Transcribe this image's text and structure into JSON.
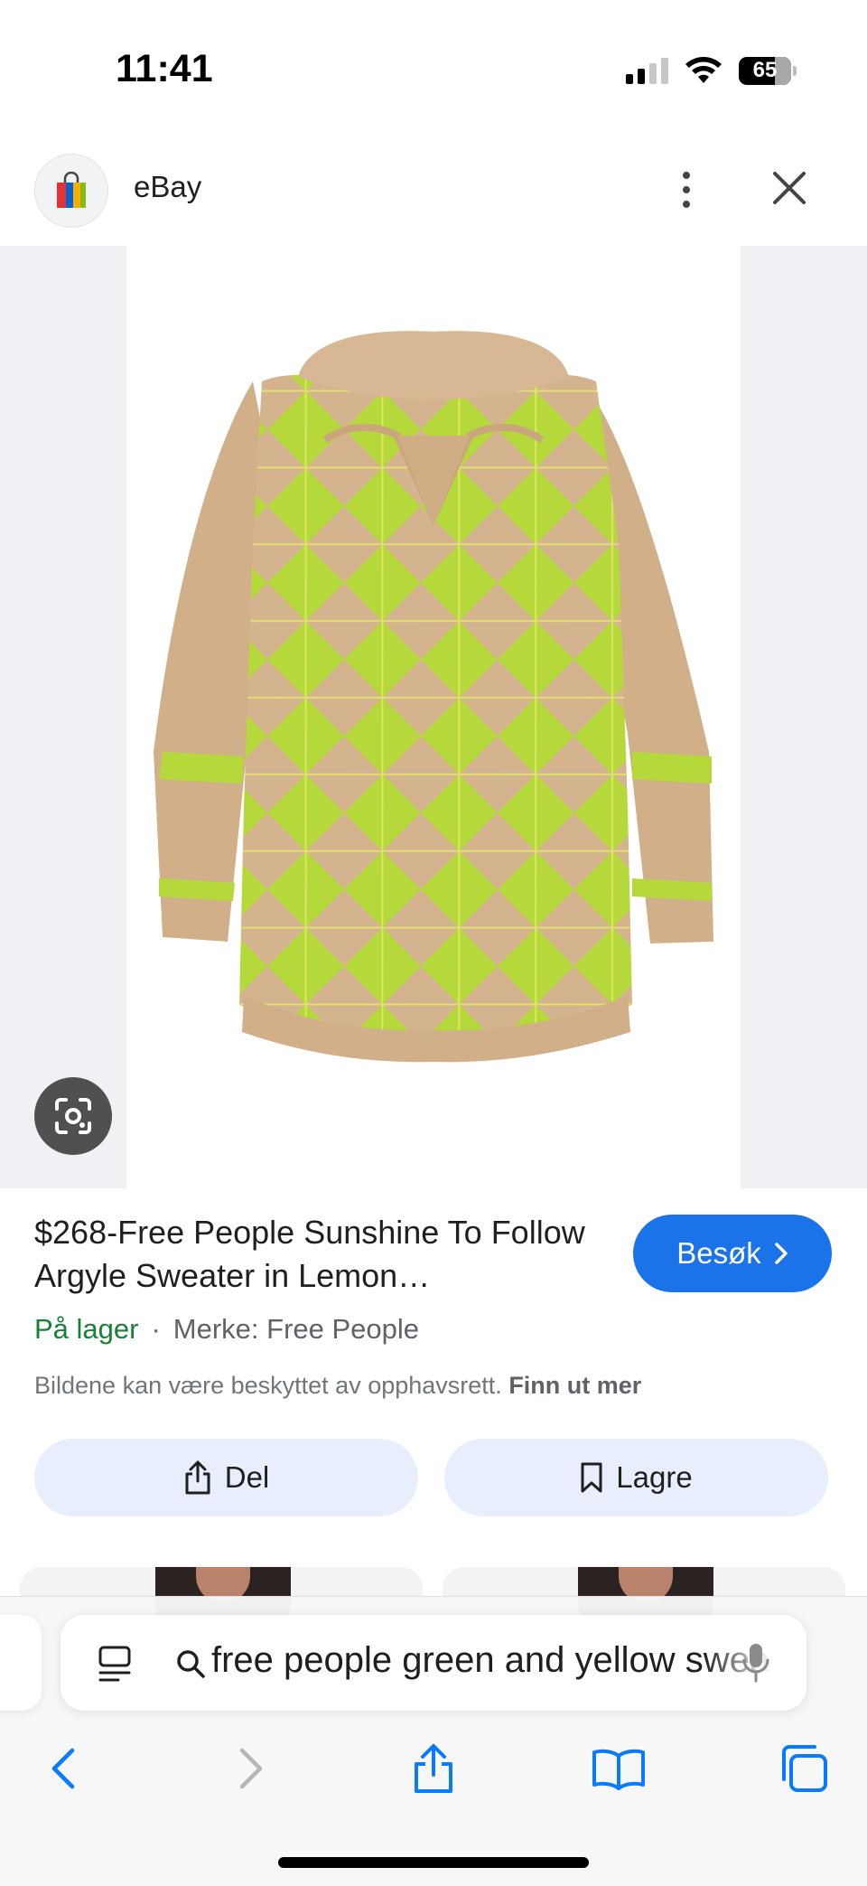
{
  "status_bar": {
    "time": "11:41",
    "battery": "65"
  },
  "site": {
    "name": "eBay",
    "logo_icon": "ebay-shopping-bag-icon"
  },
  "product": {
    "title": "$268-Free People Sunshine To Follow Argyle Sweater in Lemon…",
    "stock_status": "På lager",
    "separator": "·",
    "brand": "Merke: Free People",
    "visit_label": "Besøk",
    "image_description_icon": "argyle-sweater-image"
  },
  "notice": {
    "text": "Bildene kan være beskyttet av opphavsrett.",
    "link": "Finn ut mer"
  },
  "actions": {
    "share_label": "Del",
    "save_label": "Lagre"
  },
  "browser": {
    "address_text": "free people green and yellow sweater",
    "nav_icons": [
      "back-icon",
      "forward-icon",
      "share-icon",
      "bookmarks-icon",
      "tabs-icon"
    ]
  },
  "colors": {
    "accent": "#1a73e8",
    "in_stock": "#188038",
    "action_bg": "#e8eefb"
  }
}
